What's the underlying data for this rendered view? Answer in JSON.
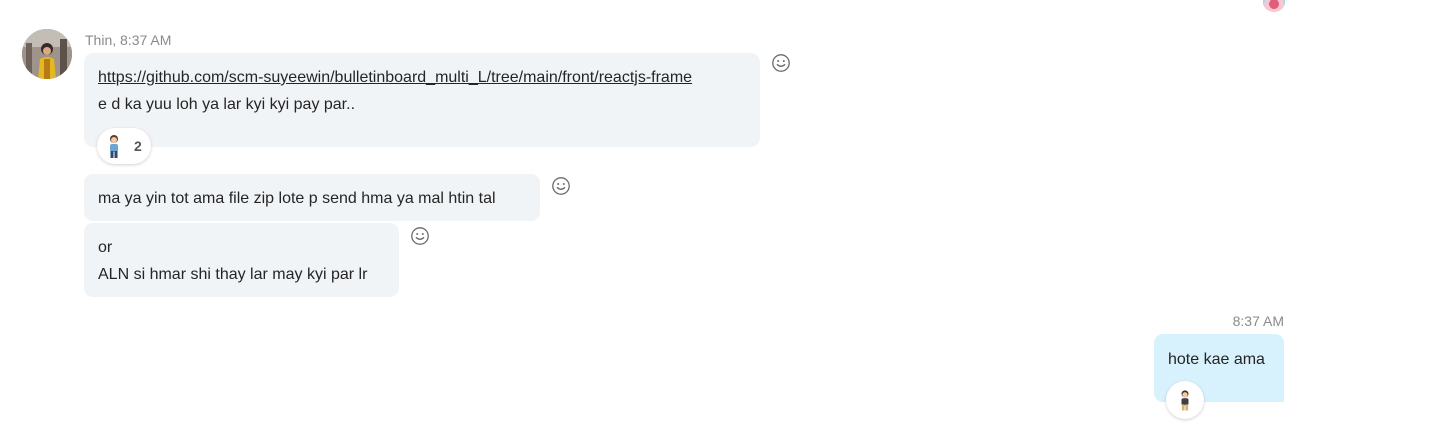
{
  "incoming": {
    "sender": "Thin",
    "time": "Thin, 8:37 AM",
    "messages": [
      {
        "link": "https://github.com/scm-suyeewin/bulletinboard_multi_L/tree/main/front/reactjs-frame",
        "text": "e d ka yuu loh ya lar kyi kyi pay par..",
        "reaction_count": "2"
      },
      {
        "text": "ma ya yin tot ama file zip lote p send hma ya mal htin tal"
      },
      {
        "lines": [
          "or",
          "ALN si hmar shi thay lar may kyi par lr"
        ]
      }
    ]
  },
  "outgoing": {
    "time": "8:37 AM",
    "text": "hote kae ama"
  },
  "icons": {
    "emoji": "smiley-icon",
    "reaction": "person-emoji-icon"
  },
  "colors": {
    "incoming_bubble": "#f1f4f7",
    "outgoing_bubble": "#d7f1fd",
    "meta_text": "#8a8a8a"
  }
}
